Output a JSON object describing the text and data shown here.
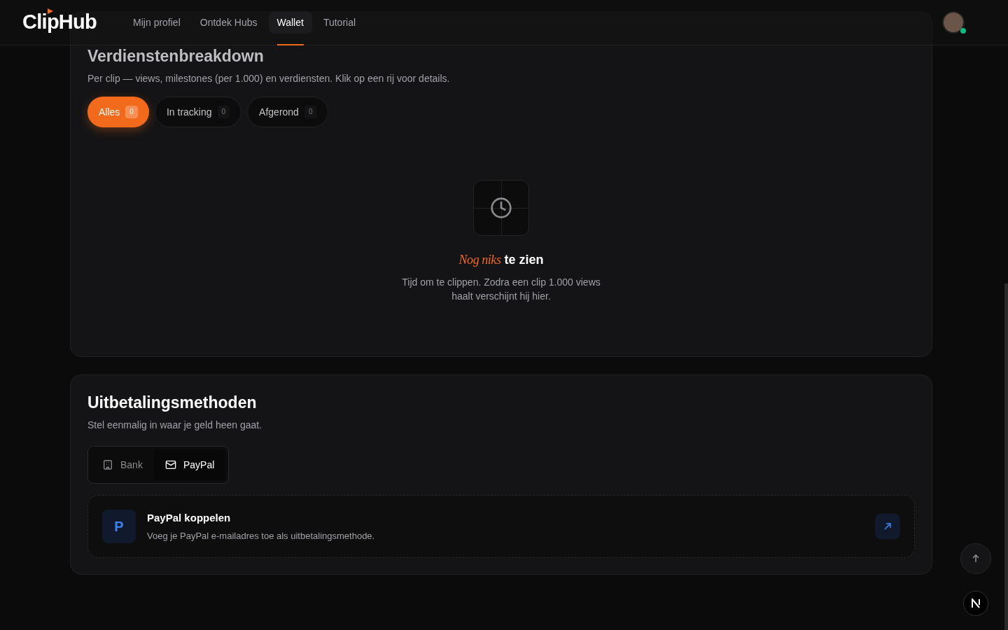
{
  "header": {
    "brand": "ClipHub",
    "nav": [
      {
        "label": "Mijn profiel",
        "selected": false
      },
      {
        "label": "Ontdek Hubs",
        "selected": false
      },
      {
        "label": "Wallet",
        "selected": true
      },
      {
        "label": "Tutorial",
        "selected": false
      }
    ],
    "avatar": {
      "online": true
    }
  },
  "earnings": {
    "title": "Verdienstenbreakdown",
    "subtitle": "Per clip — views, milestones (per 1.000) en verdiensten. Klik op een rij voor details.",
    "filters": [
      {
        "label": "Alles",
        "count": "0",
        "selected": true
      },
      {
        "label": "In tracking",
        "count": "0",
        "selected": false
      },
      {
        "label": "Afgerond",
        "count": "0",
        "selected": false
      }
    ],
    "empty": {
      "title": "*Nog niks* te zien",
      "text": "Tijd om te clippen. Zodra een clip 1.000 views haalt verschijnt hij hier."
    }
  },
  "payout": {
    "title": "Uitbetalingsmethoden",
    "subtitle": "Stel eenmalig in waar je geld heen gaat.",
    "methods": [
      {
        "label": "Bank",
        "kind": "bank",
        "selected": false
      },
      {
        "label": "PayPal",
        "kind": "mail",
        "selected": true
      }
    ],
    "connect": {
      "badge": "P",
      "title": "PayPal koppelen",
      "description": "Voeg je PayPal e-mailadres toe als uitbetalingsmethode."
    }
  }
}
